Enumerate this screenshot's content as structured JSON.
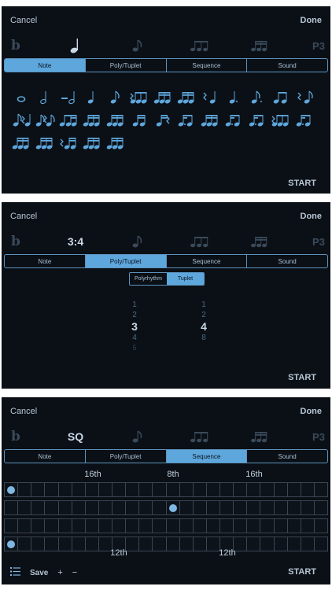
{
  "screens": [
    {
      "header": {
        "cancel": "Cancel",
        "done": "Done"
      },
      "top_row": {
        "flat": "b",
        "active": "",
        "p3": "P3"
      },
      "tabs": [
        "Note",
        "Poly/Tuplet",
        "Sequence",
        "Sound"
      ],
      "active_tab": 0,
      "note_grid": [
        "whole",
        "half",
        "dotted-half",
        "quarter",
        "eighth",
        "tuplet",
        "beamed-16th",
        "beamed-16th",
        "rest-quarter",
        "dotted-quarter",
        "dotted-eighth",
        "beamed-eighth",
        "rest-eighth",
        "eighth-rest-eighth",
        "dotted-eighth-16th",
        "beamed-eighth-16th",
        "beamed-16th",
        "beamed-16th",
        "sixteenth",
        "16th-rest",
        "dotted-16th",
        "beamed-16th",
        "dotted-16th",
        "dotted-16th",
        "tuplet",
        "dotted-16th",
        "beamed-16th",
        "beamed-16th",
        "rest-16th",
        "beamed-16th",
        "beamed-16th"
      ],
      "start": "START"
    },
    {
      "header": {
        "cancel": "Cancel",
        "done": "Done"
      },
      "top_row": {
        "flat": "b",
        "active": "3:4",
        "p3": "P3"
      },
      "tabs": [
        "Note",
        "Poly/Tuplet",
        "Sequence",
        "Sound"
      ],
      "active_tab": 1,
      "subtabs": [
        "Polyrhythm",
        "Tuplet"
      ],
      "active_subtab": 1,
      "picker_left": {
        "above2": "1",
        "above1": "2",
        "selected": "3",
        "below1": "4",
        "below2": "5"
      },
      "picker_right": {
        "above1": "1",
        "above": "2",
        "selected": "4",
        "below": "8"
      },
      "start": "START"
    },
    {
      "header": {
        "cancel": "Cancel",
        "done": "Done"
      },
      "top_row": {
        "flat": "b",
        "active": "SQ",
        "p3": "P3"
      },
      "tabs": [
        "Note",
        "Poly/Tuplet",
        "Sequence",
        "Sound"
      ],
      "active_tab": 2,
      "top_labels": [
        "16th",
        "8th",
        "16th"
      ],
      "bottom_labels": [
        "12th",
        "12th"
      ],
      "rows": [
        {
          "cells": 24,
          "dots": [
            0
          ]
        },
        {
          "cells": 24,
          "dots": [
            12
          ]
        },
        {
          "cells": 24,
          "dots": []
        },
        {
          "cells": 24,
          "dots": [
            0
          ]
        }
      ],
      "bottom": {
        "save": "Save",
        "plus": "+",
        "minus": "−"
      },
      "start": "START"
    }
  ]
}
